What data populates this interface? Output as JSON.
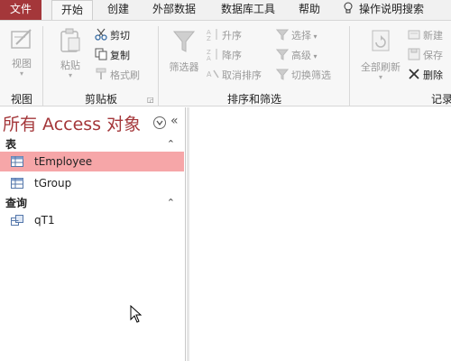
{
  "tabs": {
    "file": "文件",
    "home": "开始",
    "create": "创建",
    "external": "外部数据",
    "dbtools": "数据库工具",
    "help": "帮助",
    "tell_me": "操作说明搜索"
  },
  "ribbon": {
    "view_group": {
      "view_btn": "视图",
      "label": "视图"
    },
    "clipboard_group": {
      "paste_btn": "粘贴",
      "cut": "剪切",
      "copy": "复制",
      "format_painter": "格式刷",
      "label": "剪贴板"
    },
    "sort_filter_group": {
      "filter_btn": "筛选器",
      "ascending": "升序",
      "descending": "降序",
      "remove_sort": "取消排序",
      "selection": "选择",
      "advanced": "高级",
      "toggle_filter": "切换筛选",
      "label": "排序和筛选"
    },
    "records_group": {
      "refresh_all": "全部刷新",
      "new": "新建",
      "save": "保存",
      "delete": "删除",
      "label": "记录"
    }
  },
  "nav_pane": {
    "title": "所有 Access 对象",
    "sections": [
      {
        "header": "表",
        "items": [
          "tEmployee",
          "tGroup"
        ]
      },
      {
        "header": "查询",
        "items": [
          "qT1"
        ]
      }
    ]
  },
  "colors": {
    "accent": "#a4373a",
    "selected_row": "#f6a6a8"
  }
}
